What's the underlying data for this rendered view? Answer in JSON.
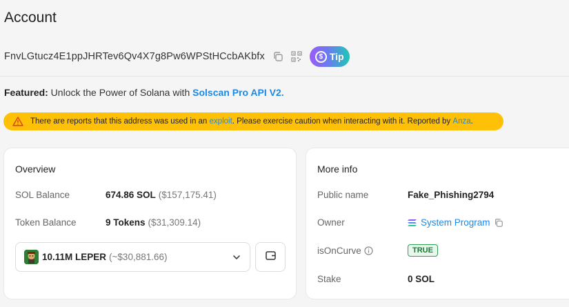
{
  "page": {
    "title": "Account"
  },
  "address": {
    "value": "FnvLGtucz4E1ppJHRTev6Qv4X7g8Pw6WPStHCcbAKbfx",
    "tip_label": "Tip"
  },
  "featured": {
    "prefix": "Featured:",
    "text": " Unlock the Power of Solana with ",
    "link": "Solscan Pro API V2."
  },
  "warning": {
    "text_before": "There are reports that this address was used in an ",
    "link1": "exploit",
    "text_middle": ". Please exercise caution when interacting with it. Reported by ",
    "link2": "Anza",
    "text_after": "."
  },
  "overview": {
    "title": "Overview",
    "sol_balance_label": "SOL Balance",
    "sol_balance_value": "674.86 SOL",
    "sol_balance_usd": "($157,175.41)",
    "token_balance_label": "Token Balance",
    "token_balance_value": "9 Tokens",
    "token_balance_usd": "($31,309.14)",
    "selected_token": "10.11M LEPER",
    "selected_token_usd": "(~$30,881.66)"
  },
  "more_info": {
    "title": "More info",
    "public_name_label": "Public name",
    "public_name_value": "Fake_Phishing2794",
    "owner_label": "Owner",
    "owner_value": "System Program",
    "is_on_curve_label": "isOnCurve",
    "is_on_curve_value": "TRUE",
    "stake_label": "Stake",
    "stake_value": "0 SOL"
  },
  "colors": {
    "link": "#1e88e5",
    "warning_bg": "#ffc107",
    "true_badge": "#2e9e50"
  }
}
